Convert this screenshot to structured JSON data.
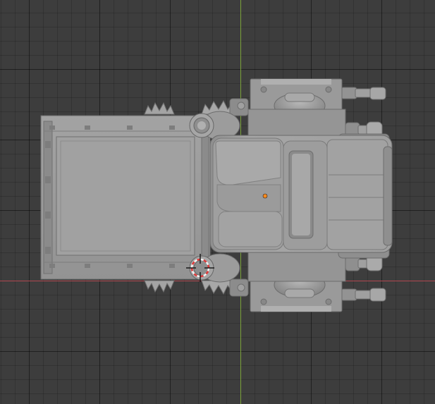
{
  "viewport": {
    "background_color": "#3d3d3d",
    "grid_color": "#2e2e2e",
    "axis_x_color": "#b1474f",
    "axis_y_color": "#7aa23a"
  },
  "model": {
    "body_color": "#9a9a9a",
    "shade_color": "#7c7c7c",
    "highlight_color": "#b4b4b4",
    "origin_color": "#ff8a1c"
  },
  "gizmo": {
    "icon": "3d-cursor-icon",
    "ring_red": "#e03b3b",
    "ring_white": "#f2f2f2"
  }
}
